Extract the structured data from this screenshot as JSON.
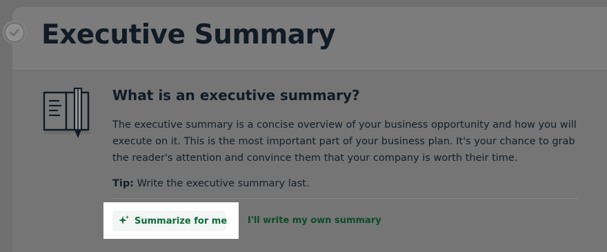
{
  "page": {
    "title": "Executive Summary"
  },
  "section": {
    "heading": "What is an executive summary?",
    "description": "The executive summary is a concise overview of your business opportunity and how you will execute on it. This is the most important part of your business plan. It's your chance to grab the reader's attention and convince them that your company is worth their time.",
    "tip_label": "Tip:",
    "tip_text": " Write the executive summary last."
  },
  "actions": {
    "summarize_label": "Summarize for me",
    "own_summary_label": "I'll write my own summary"
  },
  "icons": {
    "status": "check-circle-icon",
    "section": "book-pencil-icon",
    "summarize": "sparkle-icon"
  },
  "colors": {
    "accent_green": "#0b6b3a",
    "link_green": "#0c4a28",
    "text_dark": "#111b25"
  }
}
